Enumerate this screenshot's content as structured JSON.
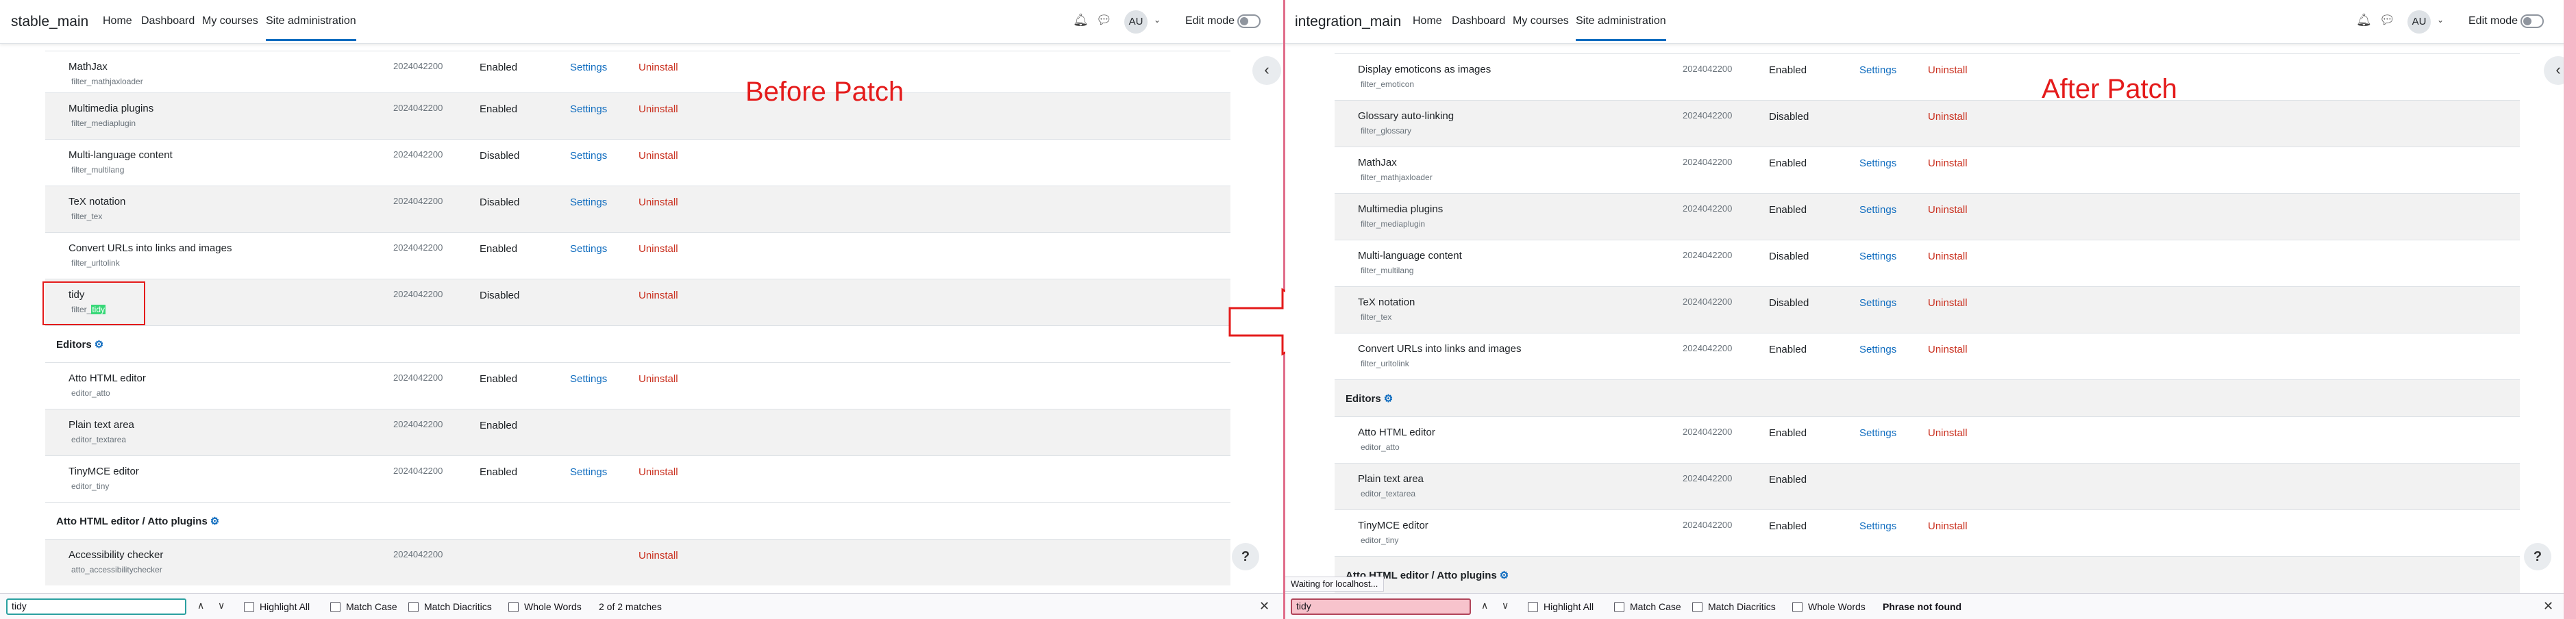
{
  "nav": {
    "links": [
      "Home",
      "Dashboard",
      "My courses",
      "Site administration"
    ],
    "edit_mode": "Edit mode",
    "avatar": "AU"
  },
  "left": {
    "site_name": "stable_main",
    "annotation": "Before Patch",
    "rows": [
      {
        "name": "MathJax",
        "component": "filter_mathjaxloader",
        "version": "2024042200",
        "status": "Enabled",
        "settings": "Settings",
        "uninstall": "Uninstall"
      },
      {
        "name": "Multimedia plugins",
        "component": "filter_mediaplugin",
        "version": "2024042200",
        "status": "Enabled",
        "settings": "Settings",
        "uninstall": "Uninstall"
      },
      {
        "name": "Multi-language content",
        "component": "filter_multilang",
        "version": "2024042200",
        "status": "Disabled",
        "settings": "Settings",
        "uninstall": "Uninstall"
      },
      {
        "name": "TeX notation",
        "component": "filter_tex",
        "version": "2024042200",
        "status": "Disabled",
        "settings": "Settings",
        "uninstall": "Uninstall"
      },
      {
        "name": "Convert URLs into links and images",
        "component": "filter_urltolink",
        "version": "2024042200",
        "status": "Enabled",
        "settings": "Settings",
        "uninstall": "Uninstall"
      },
      {
        "name": "tidy",
        "component_prefix": "filter_",
        "component_highlight": "tidy",
        "version": "2024042200",
        "status": "Disabled",
        "uninstall": "Uninstall"
      }
    ],
    "section_editors": "Editors",
    "editor_rows": [
      {
        "name": "Atto HTML editor",
        "component": "editor_atto",
        "version": "2024042200",
        "status": "Enabled",
        "settings": "Settings",
        "uninstall": "Uninstall"
      },
      {
        "name": "Plain text area",
        "component": "editor_textarea",
        "version": "2024042200",
        "status": "Enabled"
      },
      {
        "name": "TinyMCE editor",
        "component": "editor_tiny",
        "version": "2024042200",
        "status": "Enabled",
        "settings": "Settings",
        "uninstall": "Uninstall"
      }
    ],
    "section_atto": "Atto HTML editor / Atto plugins",
    "atto_rows": [
      {
        "name": "Accessibility checker",
        "component": "atto_accessibilitychecker",
        "version": "2024042200",
        "uninstall": "Uninstall"
      }
    ],
    "find": {
      "value": "tidy",
      "status": "2 of 2 matches"
    }
  },
  "right": {
    "site_name": "integration_main",
    "annotation": "After Patch",
    "rows": [
      {
        "name": "Display emoticons as images",
        "component": "filter_emoticon",
        "version": "2024042200",
        "status": "Enabled",
        "settings": "Settings",
        "uninstall": "Uninstall"
      },
      {
        "name": "Glossary auto-linking",
        "component": "filter_glossary",
        "version": "2024042200",
        "status": "Disabled",
        "uninstall": "Uninstall"
      },
      {
        "name": "MathJax",
        "component": "filter_mathjaxloader",
        "version": "2024042200",
        "status": "Enabled",
        "settings": "Settings",
        "uninstall": "Uninstall"
      },
      {
        "name": "Multimedia plugins",
        "component": "filter_mediaplugin",
        "version": "2024042200",
        "status": "Enabled",
        "settings": "Settings",
        "uninstall": "Uninstall"
      },
      {
        "name": "Multi-language content",
        "component": "filter_multilang",
        "version": "2024042200",
        "status": "Disabled",
        "settings": "Settings",
        "uninstall": "Uninstall"
      },
      {
        "name": "TeX notation",
        "component": "filter_tex",
        "version": "2024042200",
        "status": "Disabled",
        "settings": "Settings",
        "uninstall": "Uninstall"
      },
      {
        "name": "Convert URLs into links and images",
        "component": "filter_urltolink",
        "version": "2024042200",
        "status": "Enabled",
        "settings": "Settings",
        "uninstall": "Uninstall"
      }
    ],
    "section_editors": "Editors",
    "editor_rows": [
      {
        "name": "Atto HTML editor",
        "component": "editor_atto",
        "version": "2024042200",
        "status": "Enabled",
        "settings": "Settings",
        "uninstall": "Uninstall"
      },
      {
        "name": "Plain text area",
        "component": "editor_textarea",
        "version": "2024042200",
        "status": "Enabled"
      },
      {
        "name": "TinyMCE editor",
        "component": "editor_tiny",
        "version": "2024042200",
        "status": "Enabled",
        "settings": "Settings",
        "uninstall": "Uninstall"
      }
    ],
    "section_atto": "Atto HTML editor / Atto plugins",
    "waiting": "Waiting for localhost...",
    "find": {
      "value": "tidy",
      "status": "Phrase not found"
    }
  },
  "find_options": [
    "Highlight All",
    "Match Case",
    "Match Diacritics",
    "Whole Words"
  ],
  "colors": {
    "link": "#0f6cbf",
    "uninstall": "#ca3120",
    "annotation": "#e41b1b",
    "highlight": "#38d878"
  }
}
